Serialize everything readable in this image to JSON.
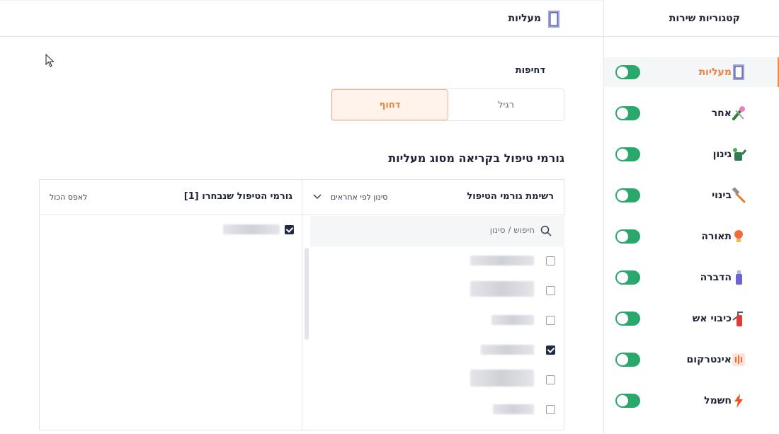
{
  "sidebar": {
    "title": "קטגוריות שירות",
    "items": [
      {
        "label": "מעליות",
        "icon": "elevator-icon",
        "enabled": true,
        "active": true
      },
      {
        "label": "אחר",
        "icon": "tools-icon",
        "enabled": true,
        "active": false
      },
      {
        "label": "גינון",
        "icon": "watering-can-icon",
        "enabled": true,
        "active": false
      },
      {
        "label": "בינוי",
        "icon": "hammer-icon",
        "enabled": true,
        "active": false
      },
      {
        "label": "תאורה",
        "icon": "light-bulb-icon",
        "enabled": true,
        "active": false
      },
      {
        "label": "הדברה",
        "icon": "spray-can-icon",
        "enabled": true,
        "active": false
      },
      {
        "label": "כיבוי אש",
        "icon": "fire-extinguisher-icon",
        "enabled": true,
        "active": false
      },
      {
        "label": "אינטרקום",
        "icon": "intercom-icon",
        "enabled": true,
        "active": false
      },
      {
        "label": "חשמל",
        "icon": "lightning-icon",
        "enabled": true,
        "active": false
      }
    ]
  },
  "header": {
    "title": "מעליות",
    "icon": "elevator-icon"
  },
  "urgency": {
    "label": "דחיפות",
    "options": [
      "רגיל",
      "דחוף"
    ],
    "selected": "דחוף"
  },
  "handlers_section": {
    "title": "גורמי טיפול בקריאה מסוג מעליות"
  },
  "handlers_list": {
    "title": "רשימת גורמי הטיפול",
    "filter_label": "סינון לפי אחראים",
    "search_placeholder": "חיפוש / סינון",
    "rows": [
      {
        "checked": false
      },
      {
        "checked": false
      },
      {
        "checked": false
      },
      {
        "checked": true
      },
      {
        "checked": false
      },
      {
        "checked": false
      }
    ]
  },
  "selected_handlers": {
    "title": "גורמי הטיפול שנבחרו [1]",
    "clear_label": "לאפס הכול",
    "rows": [
      {
        "checked": true
      }
    ]
  },
  "colors": {
    "accent": "#f0803c",
    "toggle_on": "#2aa86b",
    "text": "#1f2335",
    "border": "#e3e5ea"
  }
}
